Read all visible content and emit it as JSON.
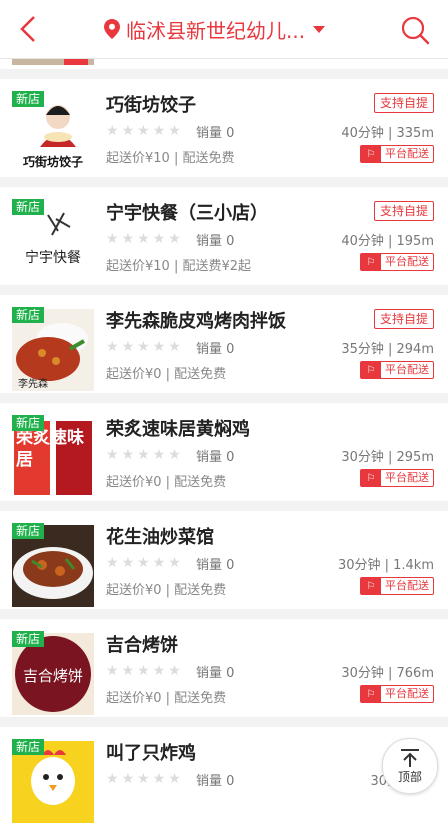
{
  "header": {
    "location": "临沭县新世纪幼儿..."
  },
  "shops": [
    {
      "name": "巧街坊饺子",
      "badge": "新店",
      "sales": "销量 0",
      "meta": "起送价¥10 | 配送免费",
      "distance": "40分钟 | 335m",
      "pickup": "支持自提",
      "delivery": "平台配送",
      "logo_text": "巧街坊饺子"
    },
    {
      "name": "宁宇快餐（三小店）",
      "badge": "新店",
      "sales": "销量 0",
      "meta": "起送价¥10 | 配送费¥2起",
      "distance": "40分钟 | 195m",
      "pickup": "支持自提",
      "delivery": "平台配送",
      "logo_text": "宁宇快餐"
    },
    {
      "name": "李先森脆皮鸡烤肉拌饭",
      "badge": "新店",
      "sales": "销量 0",
      "meta": "起送价¥0 | 配送免费",
      "distance": "35分钟 | 294m",
      "pickup": "支持自提",
      "delivery": "平台配送",
      "logo_text": "李先森"
    },
    {
      "name": "荣炙速味居黄焖鸡",
      "badge": "新店",
      "sales": "销量 0",
      "meta": "起送价¥0 | 配送免费",
      "distance": "30分钟 | 295m",
      "pickup": "",
      "delivery": "平台配送",
      "logo_text": "荣炙速味居"
    },
    {
      "name": "花生油炒菜馆",
      "badge": "新店",
      "sales": "销量 0",
      "meta": "起送价¥0 | 配送免费",
      "distance": "30分钟 | 1.4km",
      "pickup": "",
      "delivery": "平台配送"
    },
    {
      "name": "吉合烤饼",
      "badge": "新店",
      "sales": "销量 0",
      "meta": "起送价¥0 | 配送免费",
      "distance": "30分钟 | 766m",
      "pickup": "",
      "delivery": "平台配送",
      "logo_text": "吉合烤饼"
    },
    {
      "name": "叫了只炸鸡",
      "badge": "新店",
      "sales": "销量 0",
      "meta": "",
      "distance": "30分钟 | 9",
      "pickup": "",
      "delivery": ""
    }
  ],
  "top_button": {
    "label": "顶部"
  },
  "colors": {
    "accent": "#e8383d",
    "new_badge": "#20b14d"
  }
}
